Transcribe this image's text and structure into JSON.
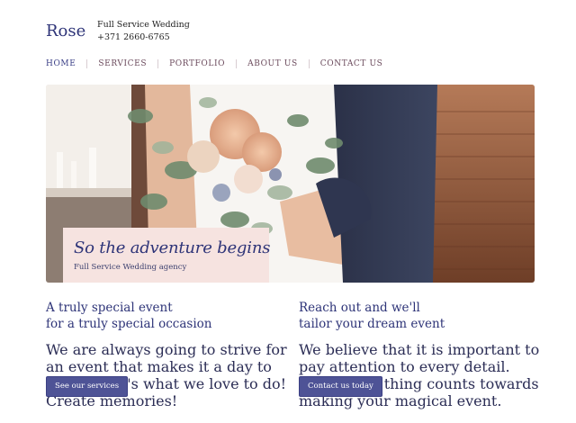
{
  "header": {
    "logo": "Rose",
    "tagline": "Full Service Wedding",
    "phone": "+371 2660-6765"
  },
  "nav": {
    "items": [
      "HOME",
      "SERVICES",
      "PORTFOLIO",
      "ABOUT US",
      "CONTACT US"
    ]
  },
  "hero": {
    "image": "wedding-couple-bouquet-photo",
    "title": "So the adventure begins",
    "subtitle": "Full Service Wedding agency"
  },
  "sections": [
    {
      "title_line1": "A truly special event",
      "title_line2": "for a truly special occasion",
      "text_line1": "We are always going to strive for an event that makes it a day to",
      "text_line2": "remeber. It's what we love to do! Create memories!",
      "button": "See our services"
    },
    {
      "title_line1": "Reach out and we'll",
      "title_line2": "tailor your dream event",
      "text_line1": "We believe that it is important to pay attention to every detail.",
      "text_line2": "Every little thing counts towards making your magical event.",
      "button": "Contact us today"
    }
  ],
  "colors": {
    "brand": "#2e3478",
    "button": "#4e5396",
    "caption_bg": "#f6e3e0",
    "nav_link": "#6b4a5c"
  }
}
